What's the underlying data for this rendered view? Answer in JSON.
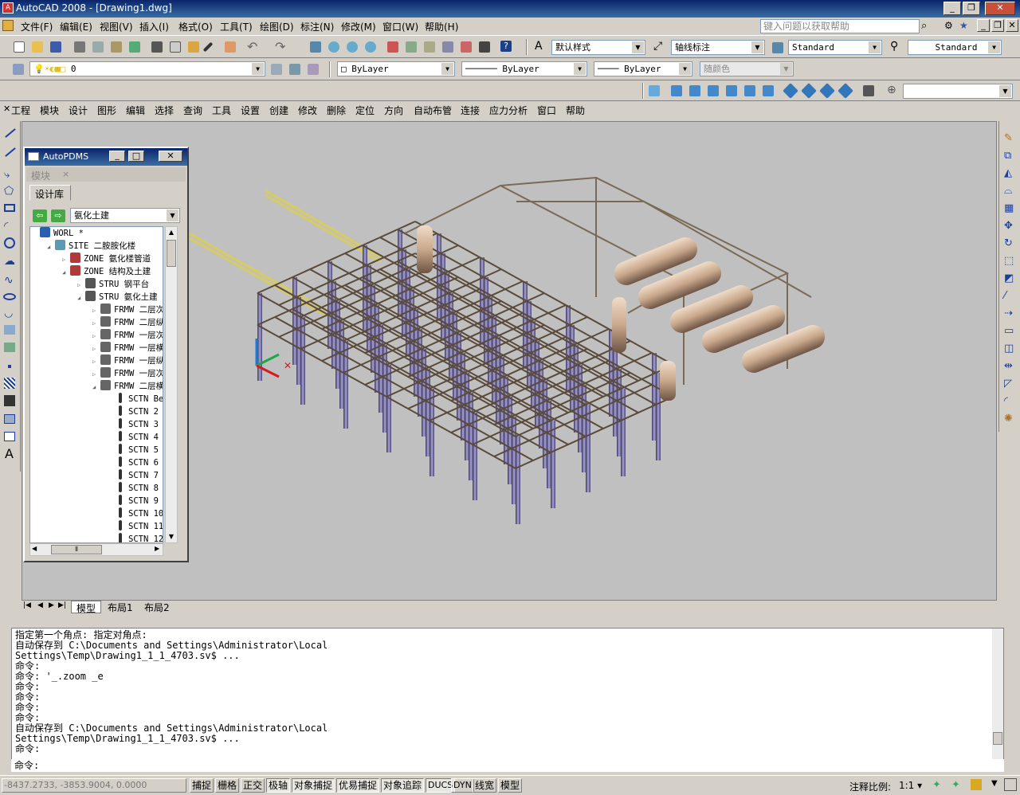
{
  "window": {
    "title": "AutoCAD 2008 - [Drawing1.dwg]",
    "app_icon": "A"
  },
  "menu": [
    "文件(F)",
    "编辑(E)",
    "视图(V)",
    "插入(I)",
    "格式(O)",
    "工具(T)",
    "绘图(D)",
    "标注(N)",
    "修改(M)",
    "窗口(W)",
    "帮助(H)"
  ],
  "help_search_placeholder": "键入问题以获取帮助",
  "toolbar_styles": {
    "text_style": "默认样式",
    "dim_style": "轴线标注",
    "table_style": "Standard",
    "mleader_style": "Standard"
  },
  "toolbar_layers": {
    "layer": "0",
    "color": "ByLayer",
    "linetype": "ByLayer",
    "lineweight": "ByLayer",
    "plotstyle": "随颜色"
  },
  "pdms_menu": [
    "工程",
    "模块",
    "设计",
    "图形",
    "编辑",
    "选择",
    "查询",
    "工具",
    "设置",
    "创建",
    "修改",
    "删除",
    "定位",
    "方向",
    "自动布管",
    "连接",
    "应力分析",
    "窗口",
    "帮助"
  ],
  "pdms_panel": {
    "title": "AutoPDMS",
    "tab_module": "模块",
    "tab_close": "×",
    "subtab": "设计库",
    "db_select": "氨化土建",
    "tree": [
      {
        "label": "WORL *",
        "level": 0,
        "icon": "globe"
      },
      {
        "label": "SITE 二胺胺化楼",
        "level": 1,
        "icon": "site"
      },
      {
        "label": "ZONE 氨化楼管道",
        "level": 2,
        "icon": "zone"
      },
      {
        "label": "ZONE 结构及土建",
        "level": 2,
        "icon": "zone"
      },
      {
        "label": "STRU 钢平台",
        "level": 3,
        "icon": "stru"
      },
      {
        "label": "STRU 氨化土建",
        "level": 3,
        "icon": "stru"
      },
      {
        "label": "FRMW 二层次梁",
        "level": 4,
        "icon": "frmw"
      },
      {
        "label": "FRMW 二层纵梁",
        "level": 4,
        "icon": "frmw"
      },
      {
        "label": "FRMW 一层次梁",
        "level": 4,
        "icon": "frmw"
      },
      {
        "label": "FRMW 一层横梁",
        "level": 4,
        "icon": "frmw"
      },
      {
        "label": "FRMW 一层纵梁",
        "level": 4,
        "icon": "frmw"
      },
      {
        "label": "FRMW 一层次纵",
        "level": 4,
        "icon": "frmw"
      },
      {
        "label": "FRMW 二层横梁",
        "level": 4,
        "icon": "frmw"
      },
      {
        "label": "SCTN Beam",
        "level": 5,
        "icon": "sctn"
      },
      {
        "label": "SCTN 2",
        "level": 5,
        "icon": "sctn"
      },
      {
        "label": "SCTN 3",
        "level": 5,
        "icon": "sctn"
      },
      {
        "label": "SCTN 4",
        "level": 5,
        "icon": "sctn"
      },
      {
        "label": "SCTN 5",
        "level": 5,
        "icon": "sctn"
      },
      {
        "label": "SCTN 6",
        "level": 5,
        "icon": "sctn"
      },
      {
        "label": "SCTN 7",
        "level": 5,
        "icon": "sctn"
      },
      {
        "label": "SCTN 8",
        "level": 5,
        "icon": "sctn"
      },
      {
        "label": "SCTN 9",
        "level": 5,
        "icon": "sctn"
      },
      {
        "label": "SCTN 10",
        "level": 5,
        "icon": "sctn"
      },
      {
        "label": "SCTN 11",
        "level": 5,
        "icon": "sctn"
      },
      {
        "label": "SCTN 12",
        "level": 5,
        "icon": "sctn"
      }
    ]
  },
  "layout_tabs": [
    "模型",
    "布局1",
    "布局2"
  ],
  "command_history": [
    "指定第一个角点: 指定对角点:",
    "自动保存到 C:\\Documents and Settings\\Administrator\\Local",
    "Settings\\Temp\\Drawing1_1_1_4703.sv$ ...",
    "命令:",
    "命令: '_.zoom _e",
    "命令:",
    "命令:",
    "命令:",
    "命令:",
    "自动保存到 C:\\Documents and Settings\\Administrator\\Local",
    "Settings\\Temp\\Drawing1_1_1_4703.sv$ ...",
    "命令:"
  ],
  "command_prompt": "命令:",
  "status": {
    "coords": "-8437.2733, -3853.9004, 0.0000",
    "toggles": [
      {
        "label": "捕捉",
        "on": false
      },
      {
        "label": "栅格",
        "on": false
      },
      {
        "label": "正交",
        "on": false
      },
      {
        "label": "极轴",
        "on": true
      },
      {
        "label": "对象捕捉",
        "on": true
      },
      {
        "label": "优易捕捉",
        "on": true
      },
      {
        "label": "对象追踪",
        "on": true
      },
      {
        "label": "DUCS",
        "on": true
      },
      {
        "label": "DYN",
        "on": false
      },
      {
        "label": "线宽",
        "on": false
      },
      {
        "label": "模型",
        "on": false
      }
    ],
    "annotation_scale_label": "注释比例:",
    "annotation_scale": "1:1"
  }
}
